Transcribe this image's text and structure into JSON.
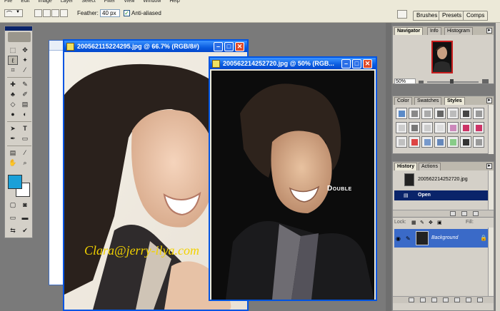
{
  "menubar": {
    "items": [
      "File",
      "Edit",
      "Image",
      "Layer",
      "Select",
      "Filter",
      "View",
      "Window",
      "Help"
    ]
  },
  "options": {
    "feather_label": "Feather:",
    "feather_value": "40 px",
    "antialias_label": "Anti-aliased",
    "antialias_checked": true,
    "palette_well": [
      "Brushes",
      "Presets",
      "Comps"
    ]
  },
  "doc1": {
    "title": "200562115224295.jpg @ 66.7% (RGB/8#)",
    "watermark": "Clara@jerry-ilya.com"
  },
  "doc2": {
    "title": "200562214252720.jpg @ 50% (RGB...",
    "overlay_text": "Double"
  },
  "navigator": {
    "tabs": [
      "Navigator",
      "Info",
      "Histogram"
    ],
    "zoom": "50%"
  },
  "styles_panel": {
    "tabs": [
      "Color",
      "Swatches",
      "Styles"
    ],
    "style_colors": [
      "#5a8ac8",
      "#888888",
      "#aaaaaa",
      "#666666",
      "#bbbbbb",
      "#444444",
      "#999999",
      "#cccccc",
      "#777777",
      "#cccccc",
      "#dddddd",
      "#cc88bb",
      "#cc3366",
      "#cc3366",
      "#c0c0c0",
      "#dd4444",
      "#7799cc",
      "#6688bb",
      "#88cc88",
      "#333333",
      "#999999"
    ]
  },
  "history": {
    "tabs": [
      "History",
      "Actions"
    ],
    "snapshot": "200562214252720.jpg",
    "steps": [
      "Open"
    ]
  },
  "layers": {
    "lock_label": "Lock:",
    "fill_label": "Fill:",
    "layer_name": "Background"
  },
  "colors": {
    "foreground": "#1aa0d8",
    "background": "#ffffff",
    "accent": "#0a246a"
  }
}
